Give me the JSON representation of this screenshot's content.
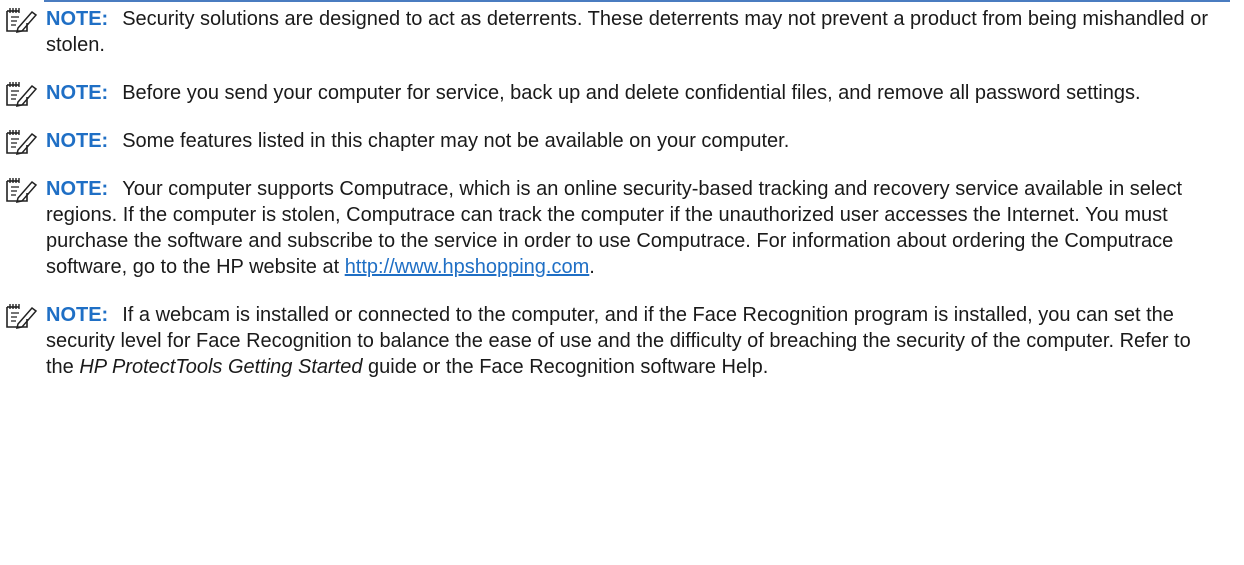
{
  "colors": {
    "accent": "#1f6fc5",
    "rule": "#4a7cc0",
    "text": "#1a1a1a"
  },
  "note_icon": "note-pad-pencil-icon",
  "notes": [
    {
      "label": "NOTE:",
      "text": "Security solutions are designed to act as deterrents. These deterrents may not prevent a product from being mishandled or stolen."
    },
    {
      "label": "NOTE:",
      "text": "Before you send your computer for service, back up and delete confidential files, and remove all password settings."
    },
    {
      "label": "NOTE:",
      "text": "Some features listed in this chapter may not be available on your computer."
    },
    {
      "label": "NOTE:",
      "text_before": "Your computer supports Computrace, which is an online security-based tracking and recovery service available in select regions. If the computer is stolen, Computrace can track the computer if the unauthorized user accesses the Internet. You must purchase the software and subscribe to the service in order to use Computrace. For information about ordering the Computrace software, go to the HP website at ",
      "link": "http://www.hpshopping.com",
      "text_after": "."
    },
    {
      "label": "NOTE:",
      "text_before": "If a webcam is installed or connected to the computer, and if the Face Recognition program is installed, you can set the security level for Face Recognition to balance the ease of use and the difficulty of breaching the security of the computer. Refer to the ",
      "italic": "HP ProtectTools Getting Started",
      "text_after": " guide or the Face Recognition software Help."
    }
  ]
}
